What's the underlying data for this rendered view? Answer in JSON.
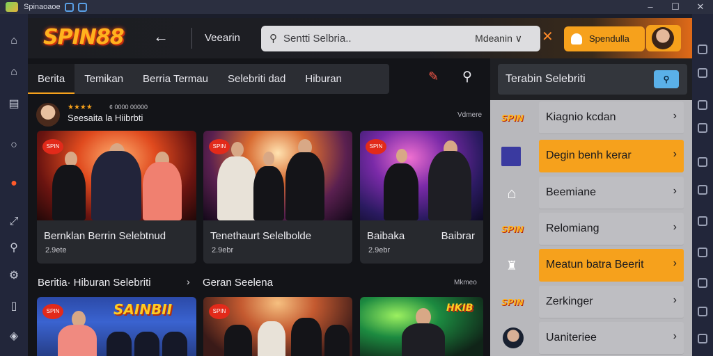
{
  "window": {
    "title": "Spinaoaoe"
  },
  "topbar": {
    "logo": "SPIN88",
    "section_label": "Veearin",
    "search_placeholder": "Sentti Selbria..",
    "search_scope": "Mdeanin ∨",
    "sponsor_label": "Spendulla"
  },
  "tabs": [
    "Berita",
    "Temikan",
    "Berria Termau",
    "Selebriti dad",
    "Hiburan"
  ],
  "feed": {
    "stars": "★★★★",
    "count": "¢ 0000 00000",
    "name": "Seesaita la Hiibrbti",
    "more": "Vdmere"
  },
  "cards": [
    {
      "badge": "SPIN",
      "title": "Bernklan Berrin Selebtnud",
      "meta": "2.9ete"
    },
    {
      "badge": "SPIN",
      "title": "Tenethaurt Selelbolde",
      "meta": "2.9ebr"
    },
    {
      "badge": "SPIN",
      "title": "Baibaka",
      "title2": "Baibrar",
      "meta": "2.9ebr"
    }
  ],
  "section2": {
    "left": "Beritia· Hiburan Selebriti",
    "right": "Geran Seelena",
    "more": "Mkmeo"
  },
  "bottom_cards": [
    {
      "badge": "SPIN",
      "banner": "SAINBII"
    },
    {
      "badge": "SPIN"
    },
    {
      "banner": "HKIB"
    }
  ],
  "right_panel": {
    "search_label": "Terabin Selebriti",
    "items": [
      {
        "label": "Kiagnio kcdan",
        "highlight": false
      },
      {
        "label": "Degin benh kerar",
        "highlight": true
      },
      {
        "label": "Beemiane",
        "highlight": false
      },
      {
        "label": "Relomiang",
        "highlight": false
      },
      {
        "label": "Meatun batra Beerit",
        "highlight": true
      },
      {
        "label": "Zerkinger",
        "highlight": false
      },
      {
        "label": "Uaniteriee",
        "highlight": false
      }
    ]
  },
  "colors": {
    "accent": "#f6a11c",
    "logo": "#ffb21e",
    "bg": "#131418"
  }
}
